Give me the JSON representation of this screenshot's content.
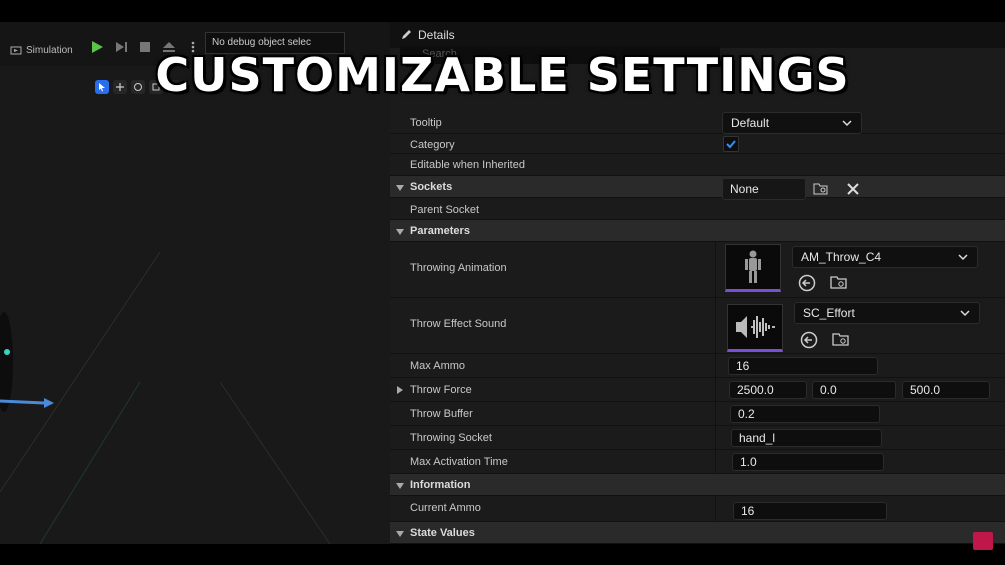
{
  "toolbar": {
    "simulation_label": "Simulation",
    "debug_object_text": "No debug object selec"
  },
  "details": {
    "title": "Details",
    "search_placeholder": "Search"
  },
  "headline": "CUSTOMIZABLE SETTINGS",
  "rows": {
    "tooltip": {
      "label": "Tooltip"
    },
    "category": {
      "label": "Category",
      "dropdown": "Default",
      "checked": true
    },
    "editable": {
      "label": "Editable when Inherited"
    },
    "sockets": {
      "label": "Sockets"
    },
    "parent_socket": {
      "label": "Parent Socket",
      "value": "None"
    },
    "parameters": {
      "label": "Parameters"
    },
    "throwing_animation": {
      "label": "Throwing Animation",
      "asset": "AM_Throw_C4"
    },
    "throw_effect_sound": {
      "label": "Throw Effect Sound",
      "asset": "SC_Effort"
    },
    "max_ammo": {
      "label": "Max Ammo",
      "value": "16"
    },
    "throw_force": {
      "label": "Throw Force",
      "x": "2500.0",
      "y": "0.0",
      "z": "500.0"
    },
    "throw_buffer": {
      "label": "Throw Buffer",
      "value": "0.2"
    },
    "throwing_socket": {
      "label": "Throwing Socket",
      "value": "hand_l"
    },
    "max_activation_time": {
      "label": "Max Activation Time",
      "value": "1.0"
    },
    "information": {
      "label": "Information"
    },
    "current_ammo": {
      "label": "Current Ammo",
      "value": "16"
    },
    "state_values": {
      "label": "State Values"
    }
  },
  "colors": {
    "accent": "#2a6ef0",
    "thumb_underline": "#7a4fd8",
    "play_green": "#5cc24a"
  }
}
